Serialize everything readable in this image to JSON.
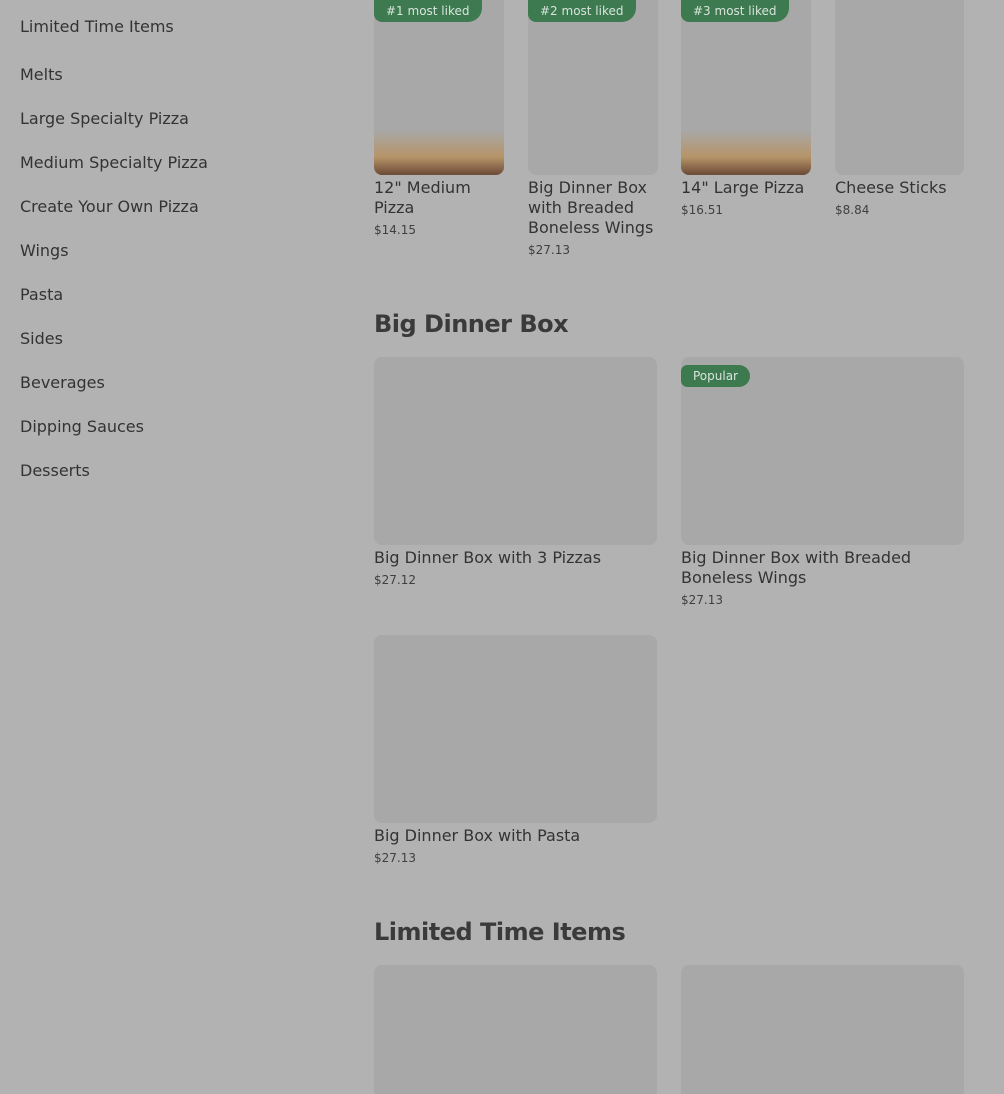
{
  "sidebar": {
    "items": [
      {
        "label": "Limited Time Items"
      },
      {
        "label": "Melts"
      },
      {
        "label": "Large Specialty Pizza"
      },
      {
        "label": "Medium Specialty Pizza"
      },
      {
        "label": "Create Your Own Pizza"
      },
      {
        "label": "Wings"
      },
      {
        "label": "Pasta"
      },
      {
        "label": "Sides"
      },
      {
        "label": "Beverages"
      },
      {
        "label": "Dipping Sauces"
      },
      {
        "label": "Desserts"
      }
    ]
  },
  "most_liked": [
    {
      "badge": "#1 most liked",
      "title": "12\" Medium Pizza",
      "price": "$14.15"
    },
    {
      "badge": "#2 most liked",
      "title": "Big Dinner Box with Breaded Boneless Wings",
      "price": "$27.13"
    },
    {
      "badge": "#3 most liked",
      "title": "14\" Large Pizza",
      "price": "$16.51"
    },
    {
      "badge": "",
      "title": "Cheese Sticks",
      "price": "$8.84"
    }
  ],
  "big_dinner_box": {
    "title": "Big Dinner Box",
    "items": [
      {
        "title": "Big Dinner Box with 3 Pizzas",
        "price": "$27.12",
        "badge": ""
      },
      {
        "title": "Big Dinner Box with Breaded Boneless Wings",
        "price": "$27.13",
        "badge": "Popular"
      },
      {
        "title": "Big Dinner Box with Pasta",
        "price": "$27.13",
        "badge": ""
      }
    ]
  },
  "limited_time": {
    "title": "Limited Time Items"
  },
  "colors": {
    "overlay_bg": "#b2b2b2",
    "placeholder": "#a8a8a8",
    "badge_green": "#3d7a4f"
  }
}
